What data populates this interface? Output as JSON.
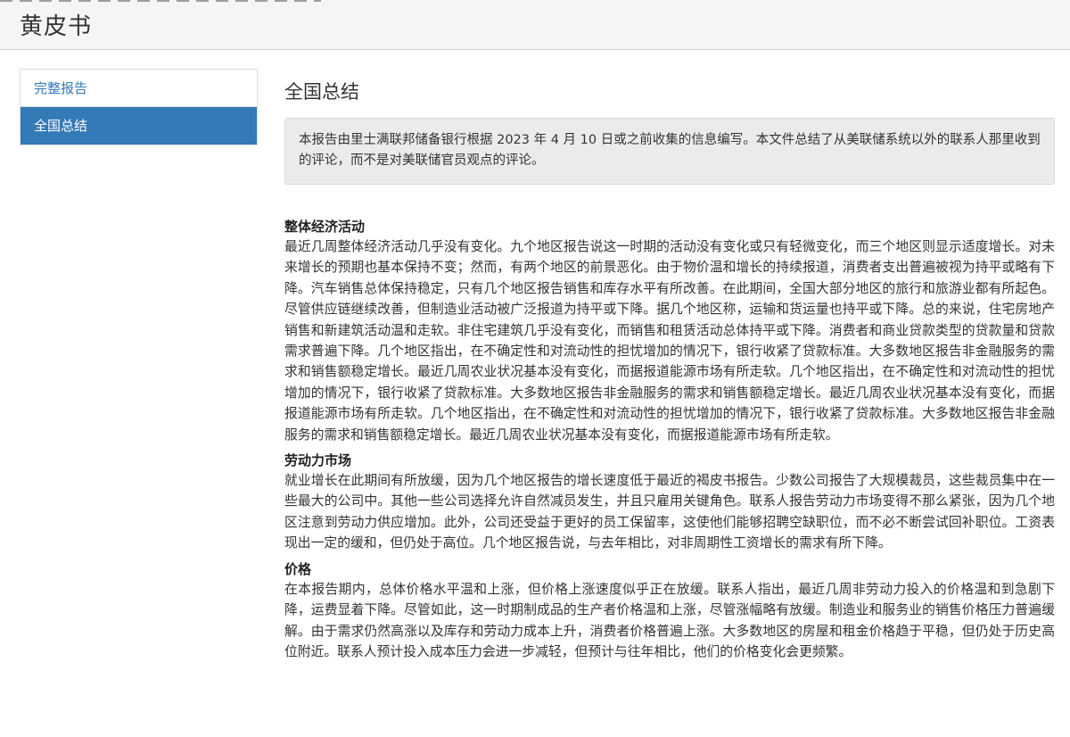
{
  "header": {
    "title": "黄皮书"
  },
  "sidebar": {
    "items": [
      {
        "label": "完整报告",
        "active": false
      },
      {
        "label": "全国总结",
        "active": true
      }
    ]
  },
  "main": {
    "title": "全国总结",
    "notice": "本报告由里士满联邦储备银行根据 2023 年 4 月 10 日或之前收集的信息编写。本文件总结了从美联储系统以外的联系人那里收到的评论，而不是对美联储官员观点的评论。",
    "sections": [
      {
        "heading": "整体经济活动",
        "body": "最近几周整体经济活动几乎没有变化。九个地区报告说这一时期的活动没有变化或只有轻微变化，而三个地区则显示适度增长。对未来增长的预期也基本保持不变；然而，有两个地区的前景恶化。由于物价温和增长的持续报道，消费者支出普遍被视为持平或略有下降。汽车销售总体保持稳定，只有几个地区报告销售和库存水平有所改善。在此期间，全国大部分地区的旅行和旅游业都有所起色。尽管供应链继续改善，但制造业活动被广泛报道为持平或下降。据几个地区称，运输和货运量也持平或下降。总的来说，住宅房地产销售和新建筑活动温和走软。非住宅建筑几乎没有变化，而销售和租赁活动总体持平或下降。消费者和商业贷款类型的贷款量和贷款需求普遍下降。几个地区指出，在不确定性和对流动性的担忧增加的情况下，银行收紧了贷款标准。大多数地区报告非金融服务的需求和销售额稳定增长。最近几周农业状况基本没有变化，而据报道能源市场有所走软。几个地区指出，在不确定性和对流动性的担忧增加的情况下，银行收紧了贷款标准。大多数地区报告非金融服务的需求和销售额稳定增长。最近几周农业状况基本没有变化，而据报道能源市场有所走软。几个地区指出，在不确定性和对流动性的担忧增加的情况下，银行收紧了贷款标准。大多数地区报告非金融服务的需求和销售额稳定增长。最近几周农业状况基本没有变化，而据报道能源市场有所走软。"
      },
      {
        "heading": "劳动力市场",
        "body": "就业增长在此期间有所放缓，因为几个地区报告的增长速度低于最近的褐皮书报告。少数公司报告了大规模裁员，这些裁员集中在一些最大的公司中。其他一些公司选择允许自然减员发生，并且只雇用关键角色。联系人报告劳动力市场变得不那么紧张，因为几个地区注意到劳动力供应增加。此外，公司还受益于更好的员工保留率，这使他们能够招聘空缺职位，而不必不断尝试回补职位。工资表现出一定的缓和，但仍处于高位。几个地区报告说，与去年相比，对非周期性工资增长的需求有所下降。"
      },
      {
        "heading": "价格",
        "body": "在本报告期内，总体价格水平温和上涨，但价格上涨速度似乎正在放缓。联系人指出，最近几周非劳动力投入的价格温和到急剧下降，运费显着下降。尽管如此，这一时期制成品的生产者价格温和上涨，尽管涨幅略有放缓。制造业和服务业的销售价格压力普遍缓解。由于需求仍然高涨以及库存和劳动力成本上升，消费者价格普遍上涨。大多数地区的房屋和租金价格趋于平稳，但仍处于历史高位附近。联系人预计投入成本压力会进一步减轻，但预计与往年相比，他们的价格变化会更频繁。"
      }
    ]
  }
}
